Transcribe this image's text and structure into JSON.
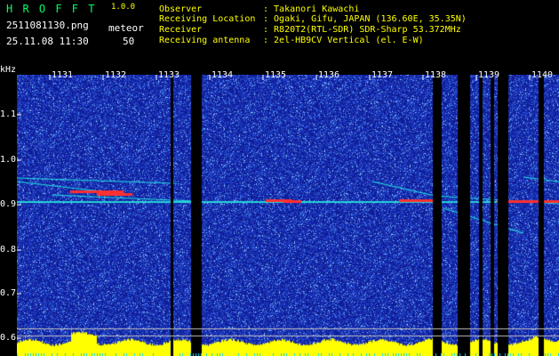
{
  "app": {
    "title": "H R O F F T",
    "version": "1.0.0",
    "filename": "2511081130.png",
    "timestamp": "25.11.08 11:30",
    "meteor_label": "meteor",
    "meteor_count": "50"
  },
  "info": {
    "observer_label": "Observer",
    "observer_value": ": Takanori Kawachi",
    "location_label": "Receiving Location",
    "location_value": ": Ogaki, Gifu, JAPAN (136.60E, 35.35N)",
    "receiver_label": "Receiver",
    "receiver_value": ": R820T2(RTL-SDR) SDR-Sharp 53.372MHz",
    "antenna_label": "Receiving antenna",
    "antenna_value": ": 2el-HB9CV Vertical (el. E-W)"
  },
  "chart_data": {
    "type": "heatmap",
    "ylabel": "kHz",
    "yticks": [
      "1.1",
      "1.0",
      "0.9",
      "0.8",
      "0.7",
      "0.6"
    ],
    "xticks": [
      "1131",
      "1132",
      "1133",
      "1134",
      "1135",
      "1136",
      "1137",
      "1138",
      "1139",
      "1140"
    ],
    "background": "#1a2fb0",
    "gap_color": "#000000",
    "signal_color": "#ff3030",
    "trace_color": "#20e0e0",
    "level_color": "#ffff00"
  }
}
